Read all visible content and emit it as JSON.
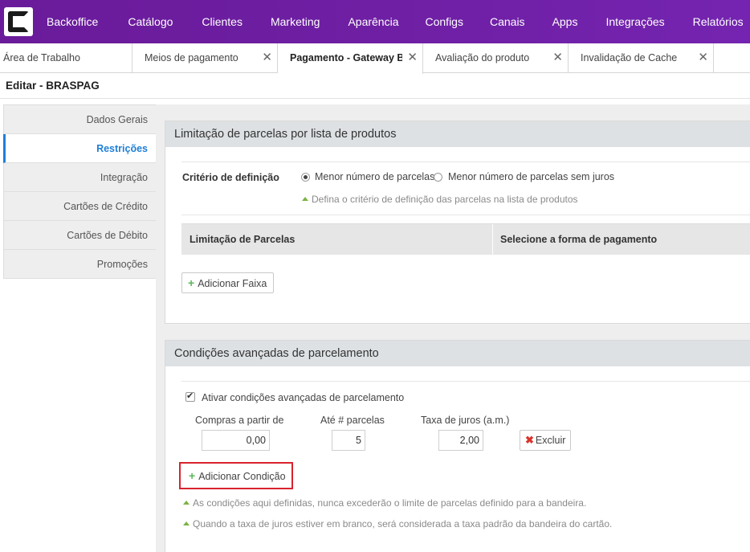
{
  "topnav": {
    "logo_icon": "c-logo-icon",
    "items": [
      "Backoffice",
      "Catálogo",
      "Clientes",
      "Marketing",
      "Aparência",
      "Configs",
      "Canais",
      "Apps",
      "Integrações",
      "Relatórios"
    ]
  },
  "tabs": [
    {
      "label": "Área de Trabalho"
    },
    {
      "label": "Meios de pagamento",
      "close": "✕"
    },
    {
      "label": "Pagamento - Gateway Br",
      "close": "✕"
    },
    {
      "label": "Avaliação do produto",
      "close": "✕"
    },
    {
      "label": "Invalidação de Cache",
      "close": "✕"
    }
  ],
  "page": {
    "title": "Editar - BRASPAG"
  },
  "sidebar": {
    "items": [
      "Dados Gerais",
      "Restrições",
      "Integração",
      "Cartões de Crédito",
      "Cartões de Débito",
      "Promoções"
    ],
    "active": "Restrições"
  },
  "panel1": {
    "title": "Limitação de parcelas por lista de produtos",
    "criterio_label": "Critério de definição",
    "radio_options": [
      "Menor número de parcelas",
      "Menor número de parcelas sem juros"
    ],
    "selected_option": "Menor número de parcelas",
    "hint": "Defina o critério de definição das parcelas na lista de produtos",
    "table_headers": [
      "Limitação de Parcelas",
      "Selecione a forma de pagamento"
    ],
    "add_button": "Adicionar Faixa"
  },
  "panel2": {
    "title": "Condições avançadas de parcelamento",
    "checkbox_label": "Ativar condições avançadas de parcelamento",
    "checkbox_checked": true,
    "columns": [
      "Compras a partir de",
      "Até # parcelas",
      "Taxa de juros (a.m.)"
    ],
    "row": {
      "compras": "0,00",
      "parcelas": "5",
      "taxa": "2,00"
    },
    "delete_button": "Excluir",
    "add_button": "Adicionar Condição",
    "hints": [
      "As condições aqui definidas, nunca excederão o limite de parcelas definido para a bandeira.",
      "Quando a taxa de juros estiver em branco, será considerada a taxa padrão da bandeira do cartão."
    ]
  },
  "colors": {
    "nav_bg": "#6e1fa3",
    "active_link": "#1e7fd8",
    "add_icon": "#5cb85c",
    "delete_icon": "#d9342b",
    "highlight": "#d9232e"
  }
}
